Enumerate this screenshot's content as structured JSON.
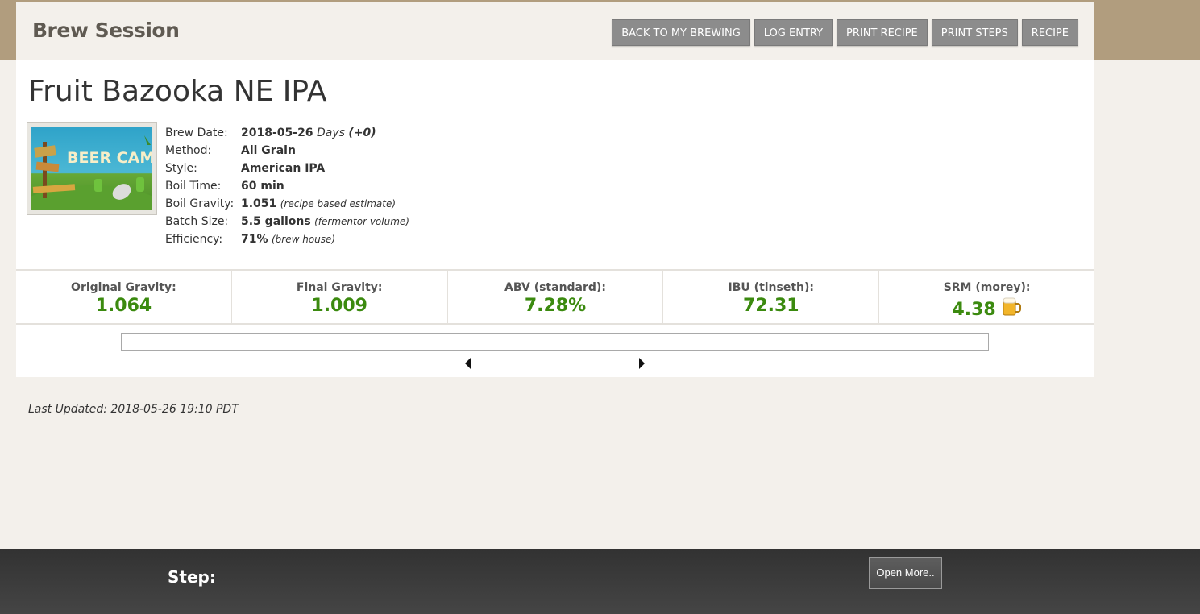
{
  "header": {
    "title": "Brew Session",
    "buttons": [
      "BACK TO MY BREWING",
      "LOG ENTRY",
      "PRINT RECIPE",
      "PRINT STEPS",
      "RECIPE"
    ]
  },
  "recipe": {
    "title": "Fruit Bazooka NE IPA",
    "image_text": "BEER CAMP",
    "details": [
      {
        "label": "Brew Date:",
        "value": "2018-05-26",
        "note": "Days",
        "extra": "(+0)"
      },
      {
        "label": "Method:",
        "value": "All Grain",
        "note": ""
      },
      {
        "label": "Style:",
        "value": "American IPA",
        "note": ""
      },
      {
        "label": "Boil Time:",
        "value": "60 min",
        "note": ""
      },
      {
        "label": "Boil Gravity:",
        "value": "1.051",
        "note": "(recipe based estimate)"
      },
      {
        "label": "Batch Size:",
        "value": "5.5 gallons",
        "note": "(fermentor volume)"
      },
      {
        "label": "Efficiency:",
        "value": "71%",
        "note": "(brew house)"
      }
    ]
  },
  "stats": [
    {
      "label": "Original Gravity:",
      "value": "1.064"
    },
    {
      "label": "Final Gravity:",
      "value": "1.009"
    },
    {
      "label": "ABV (standard):",
      "value": "7.28%"
    },
    {
      "label": "IBU (tinseth):",
      "value": "72.31"
    },
    {
      "label": "SRM (morey):",
      "value": "4.38",
      "icon": "beer-mug-icon"
    }
  ],
  "last_updated": "Last Updated: 2018-05-26 19:10 PDT",
  "footer": {
    "step_label": "Step:",
    "open_more_label": "Open More.."
  },
  "colors": {
    "stat_value": "#3b8a0f",
    "button_bg": "#8c8c8c",
    "top_band": "#b19d7e"
  }
}
